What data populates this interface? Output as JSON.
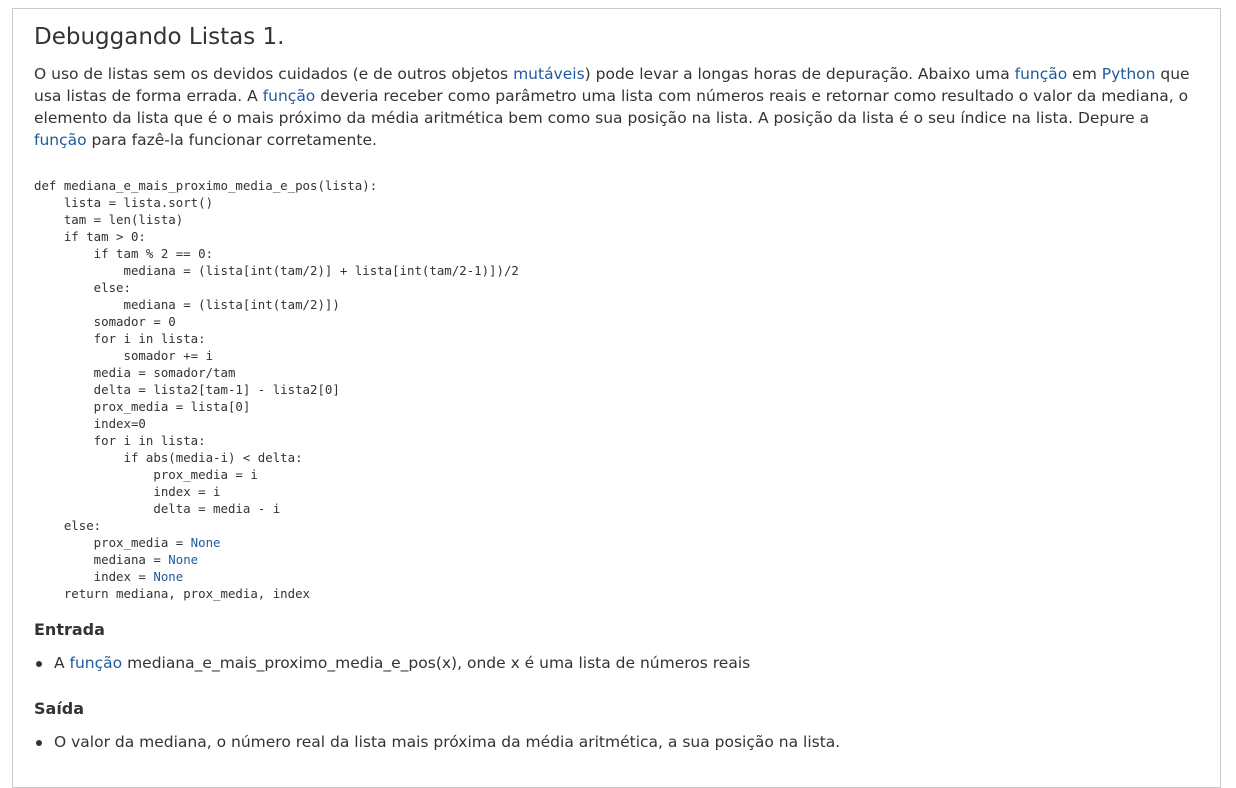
{
  "title": "Debuggando Listas 1.",
  "intro": {
    "t1": "O uso de listas sem os devidos cuidados (e de outros objetos ",
    "l1": "mutáveis",
    "t2": ") pode levar a longas horas de depuração. Abaixo uma ",
    "l2": "função",
    "t3": " em ",
    "l3": "Python",
    "t4": " que usa listas de forma errada. A ",
    "l4": "função",
    "t5": " deveria receber como parâmetro uma lista com números reais e retornar como resultado o valor da mediana, o elemento da lista que é o mais próximo da média aritmética bem como sua posição na lista. A posição da lista é o seu índice na lista. Depure a ",
    "l5": "função",
    "t6": " para fazê-la funcionar corretamente."
  },
  "code": {
    "main": "def mediana_e_mais_proximo_media_e_pos(lista):\n    lista = lista.sort()\n    tam = len(lista)\n    if tam > 0:\n        if tam % 2 == 0:\n            mediana = (lista[int(tam/2)] + lista[int(tam/2-1)])/2\n        else:\n            mediana = (lista[int(tam/2)])\n        somador = 0\n        for i in lista:\n            somador += i\n        media = somador/tam\n        delta = lista2[tam-1] - lista2[0]\n        prox_media = lista[0]\n        index=0\n        for i in lista:\n            if abs(media-i) < delta:\n                prox_media = i\n                index = i\n                delta = media - i\n    else:\n",
    "l1_pre": "        prox_media = ",
    "l2_pre": "        mediana = ",
    "l3_pre": "        index = ",
    "none": "None",
    "tail": "\n    return mediana, prox_media, index"
  },
  "entrada": {
    "heading": "Entrada",
    "item_pre": "A ",
    "item_link": "função",
    "item_post": " mediana_e_mais_proximo_media_e_pos(x), onde x é uma lista de números reais"
  },
  "saida": {
    "heading": "Saída",
    "item": "O valor da mediana, o número real da lista mais próxima da média aritmética, a sua posição na lista."
  },
  "colors": {
    "link": "#1f5a9c",
    "text": "#333333",
    "border": "#c9c9c9"
  }
}
